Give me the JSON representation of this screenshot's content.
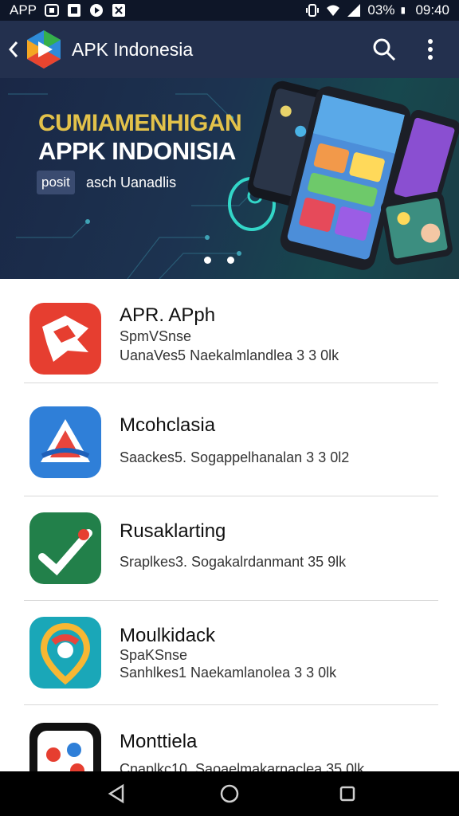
{
  "status_bar": {
    "carrier": "APP",
    "battery": "03%",
    "time": "09:40"
  },
  "app_bar": {
    "title": "APK Indonesia",
    "icons": [
      "back-icon",
      "app-logo",
      "search-icon",
      "more-vert-icon"
    ]
  },
  "banner": {
    "line1": "CUMIAMENHIGAN",
    "line2": "APPK INDONISIA",
    "chip": "posit",
    "subtitle": "asch Uanadlis"
  },
  "apps": [
    {
      "name": "APR. APph",
      "meta1": "SpmVSnse",
      "meta2": "UanaVes5   Naekalmlandlea 3 3 0lk"
    },
    {
      "name": "Mcohclasia",
      "meta1": "",
      "meta2": "Saackes5.  Sogappelhanalan 3 3 0l2"
    },
    {
      "name": "Rusaklarting",
      "meta1": "",
      "meta2": "Sraplkes3.  Sogakalrdanmant 35 9lk"
    },
    {
      "name": "Moulkidack",
      "meta1": "SpaKSnse",
      "meta2": "Sanhlkes1   Naekamlanolea 3 3 0lk"
    },
    {
      "name": "Monttiela",
      "meta1": "",
      "meta2": "Cnaplkc10.  Saoaelmakarnaclea 35 0lk"
    }
  ],
  "colors": {
    "status_bar": "#0e1628",
    "app_bar": "#23304e",
    "banner_gold": "#e3c24a",
    "divider": "#d8d8d8"
  }
}
